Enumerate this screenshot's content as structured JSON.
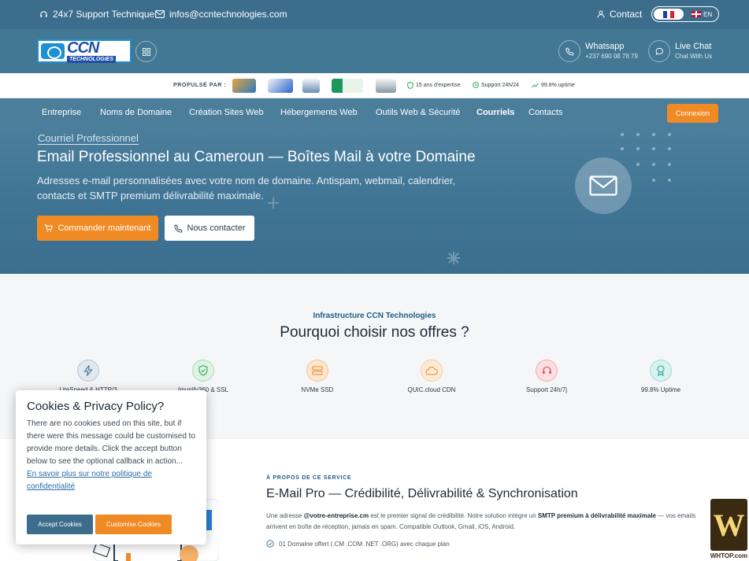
{
  "topbar": {
    "support": "24x7 Support Technique",
    "email": "infos@ccntechnologies.com",
    "contact": "Contact",
    "lang_en": "EN"
  },
  "header": {
    "logo_text": "CCN",
    "logo_sub": "TECHNOLOGIES",
    "whatsapp_label": "Whatsapp",
    "whatsapp_number": "+237 690 08 78 79",
    "chat_label": "Live Chat",
    "chat_sub": "Chat With Us"
  },
  "partners": {
    "label": "PROPULSÉ PAR :",
    "badges": [
      "15 ans d'expertise",
      "Support 24h/24",
      "99.8% uptime"
    ]
  },
  "nav": {
    "items": [
      "Entreprise",
      "Noms de Domaine",
      "Création Sites Web",
      "Hébergements Web",
      "Outils Web & Sécurité",
      "Courriels",
      "Contacts"
    ],
    "login": "Connexion"
  },
  "hero": {
    "eyebrow": "Courriel Professionnel",
    "title": "Email Professionnel au Cameroun — Boîtes Mail à votre Domaine",
    "description": "Adresses e-mail personnalisées avec votre nom de domaine. Antispam, webmail, calendrier, contacts et SMTP premium délivrabilité maximale.",
    "cta_order": "Commander maintenant",
    "cta_contact": "Nous contacter"
  },
  "why": {
    "eyebrow": "Infrastructure CCN Technologies",
    "title": "Pourquoi choisir nos offres ?",
    "features": [
      {
        "label": "LiteSpeed & HTTP/3",
        "icon": "bolt-icon",
        "color": "#4b7e9b"
      },
      {
        "label": "Imunify360 & SSL",
        "icon": "shield-check-icon",
        "color": "#35a85a"
      },
      {
        "label": "NVMe SSD",
        "icon": "server-icon",
        "color": "#f08a24"
      },
      {
        "label": "QUIC.cloud CDN",
        "icon": "cloud-icon",
        "color": "#f08a24"
      },
      {
        "label": "Support 24h/7j",
        "icon": "headset-icon",
        "color": "#e0455a"
      },
      {
        "label": "99.8% Uptime",
        "icon": "award-icon",
        "color": "#1ea6a0"
      }
    ]
  },
  "about": {
    "eyebrow": "À PROPOS DE CE SERVICE",
    "title": "E-Mail Pro — Crédibilité, Délivrabilité & Synchronisation",
    "text_1": "Une adresse ",
    "text_b1": "@votre-entreprise.cm",
    "text_2": " est le premier signal de crédibilité. Notre solution intègre un ",
    "text_b2": "SMTP premium à délivrabilité maximale",
    "text_3": " — vos emails arrivent en boîte de réception, jamais en spam. Compatible Outlook, Gmail, iOS, Android.",
    "list_1": "01 Domaine offert (.CM .COM .NET .ORG) avec chaque plan"
  },
  "cookie": {
    "title": "Cookies & Privacy Policy?",
    "body": "There are no cookies used on this site, but if there were this message could be customised to provide more details. Click the accept button below to see the optional callback in action...",
    "link": "En savoir plus sur notre politique de confidentialité",
    "accept": "Accept Cookies",
    "customise": "Customise Cookies"
  },
  "watermark": {
    "text": "WHTOP.com"
  },
  "colors": {
    "topbar": "#3c6d8c",
    "accent": "#f08a24",
    "nav": "#4b7e9b"
  }
}
